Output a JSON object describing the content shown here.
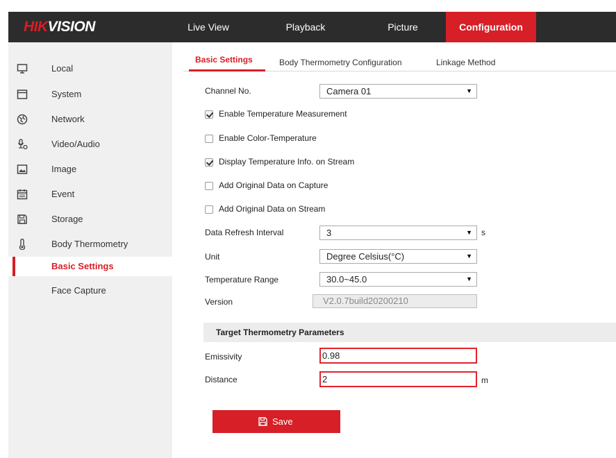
{
  "brand": {
    "part1": "HIK",
    "part2": "VISION"
  },
  "nav": {
    "live_view": "Live View",
    "playback": "Playback",
    "picture": "Picture",
    "configuration": "Configuration"
  },
  "sidebar": {
    "items": [
      {
        "label": "Local",
        "icon": "monitor-icon"
      },
      {
        "label": "System",
        "icon": "system-icon"
      },
      {
        "label": "Network",
        "icon": "network-icon"
      },
      {
        "label": "Video/Audio",
        "icon": "video-audio-icon"
      },
      {
        "label": "Image",
        "icon": "image-icon"
      },
      {
        "label": "Event",
        "icon": "calendar-icon"
      },
      {
        "label": "Storage",
        "icon": "storage-icon"
      },
      {
        "label": "Body Thermometry",
        "icon": "thermometer-icon"
      }
    ],
    "sub_items": [
      {
        "label": "Basic Settings",
        "active": true
      },
      {
        "label": "Face Capture",
        "active": false
      }
    ]
  },
  "tabs": [
    "Basic Settings",
    "Body Thermometry Configuration",
    "Linkage Method"
  ],
  "form": {
    "channel_label": "Channel No.",
    "channel_value": "Camera 01",
    "checkboxes": [
      {
        "label": "Enable Temperature Measurement",
        "checked": true
      },
      {
        "label": "Enable Color-Temperature",
        "checked": false
      },
      {
        "label": "Display Temperature Info. on Stream",
        "checked": true
      },
      {
        "label": "Add Original Data on Capture",
        "checked": false
      },
      {
        "label": "Add Original Data on Stream",
        "checked": false
      }
    ],
    "refresh_label": "Data Refresh Interval",
    "refresh_value": "3",
    "refresh_unit": "s",
    "unit_label": "Unit",
    "unit_value": "Degree Celsius(°C)",
    "range_label": "Temperature Range",
    "range_value": "30.0~45.0",
    "version_label": "Version",
    "version_value": "V2.0.7build20200210",
    "section_title": "Target Thermometry Parameters",
    "emissivity_label": "Emissivity",
    "emissivity_value": "0.98",
    "distance_label": "Distance",
    "distance_value": "2",
    "distance_unit": "m",
    "save_label": "Save"
  },
  "colors": {
    "accent": "#d61f26",
    "nav_bg": "#2c2c2c",
    "sidebar_bg": "#f0f0f0"
  }
}
